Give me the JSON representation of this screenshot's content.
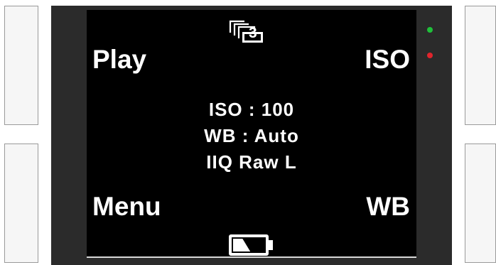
{
  "device": {
    "screen": {
      "soft_keys": {
        "top_left": "Play",
        "top_right": "ISO",
        "bottom_left": "Menu",
        "bottom_right": "WB"
      },
      "status": {
        "iso": "ISO : 100",
        "white_balance": "WB : Auto",
        "file_format": "IIQ Raw L"
      },
      "image_stack": {
        "icon": "image-stack-icon",
        "count": "3"
      },
      "battery": {
        "icon": "battery-icon",
        "level": 0.55
      }
    },
    "leds": [
      {
        "name": "status-led-green",
        "color": "#1fbf3a"
      },
      {
        "name": "status-led-red",
        "color": "#e0242c"
      }
    ]
  }
}
